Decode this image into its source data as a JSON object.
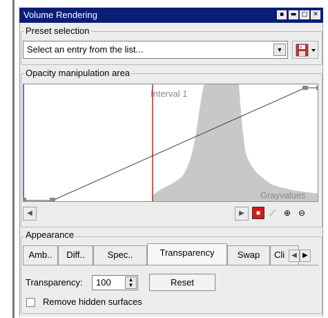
{
  "window": {
    "title": "Volume Rendering"
  },
  "preset": {
    "group_label": "Preset selection",
    "combo_value": "Select an entry from the list...",
    "combo_arrow_icon": "chevron-down-icon",
    "save_icon": "save-preset-icon"
  },
  "opacity": {
    "group_label": "Opacity manipulation area",
    "interval_label": "Interval 1",
    "axis_label": "Grayvalues"
  },
  "appearance": {
    "group_label": "Appearance",
    "tabs": [
      {
        "label": "Amb.."
      },
      {
        "label": "Diff.."
      },
      {
        "label": "Spec.."
      },
      {
        "label": "Transparency"
      },
      {
        "label": "Swap"
      },
      {
        "label": "Cli"
      }
    ],
    "transparency_label": "Transparency:",
    "transparency_value": "100",
    "reset_label": "Reset",
    "remove_hidden_label": "Remove hidden surfaces"
  },
  "colors": {
    "titlebar": "#0a1e78",
    "histogram": "#c8c8c8",
    "interval_line": "#d81818"
  }
}
